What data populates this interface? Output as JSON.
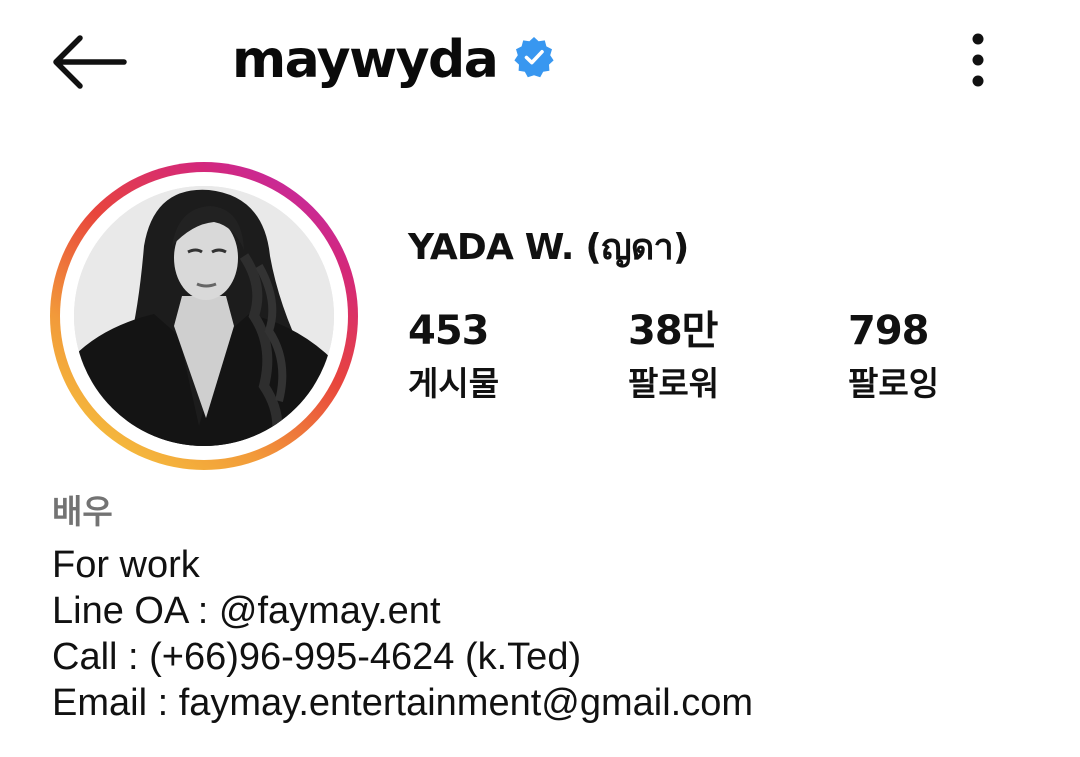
{
  "header": {
    "username": "maywyda",
    "verified_color": "#3897f0"
  },
  "profile": {
    "display_name": "YADA W. (ญดา)",
    "stats": {
      "posts": {
        "value": "453",
        "label": "게시물"
      },
      "followers": {
        "value": "38만",
        "label": "팔로워"
      },
      "following": {
        "value": "798",
        "label": "팔로잉"
      }
    }
  },
  "bio": {
    "category": "배우",
    "lines": [
      "For work",
      "Line OA : @faymay.ent",
      "Call : (+66)96-995-4624 (k.Ted)",
      "Email : faymay.entertainment@gmail.com"
    ]
  },
  "icons": {
    "back": "back-arrow-icon",
    "verified": "verified-badge-icon",
    "more": "more-vertical-icon"
  },
  "colors": {
    "text": "#111111",
    "category": "#737373",
    "ring_start": "#f6cf3e",
    "ring_end": "#b52cc9"
  }
}
